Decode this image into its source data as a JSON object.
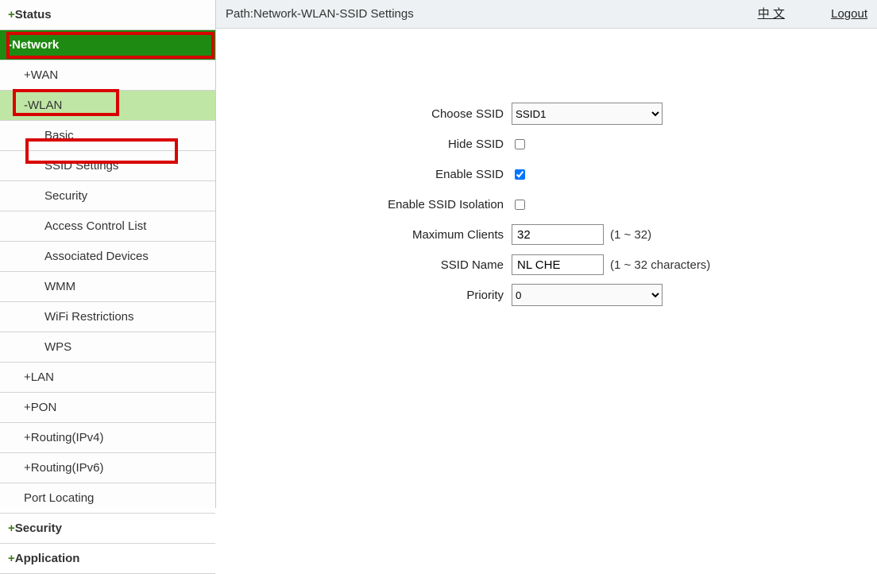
{
  "sidebar": {
    "status": {
      "label": "Status",
      "prefix": "+"
    },
    "network": {
      "label": "Network",
      "prefix": "-"
    },
    "wan": {
      "label": "WAN",
      "prefix": "+"
    },
    "wlan": {
      "label": "WLAN",
      "prefix": "-"
    },
    "basic": {
      "label": "Basic"
    },
    "ssid": {
      "label": "SSID Settings"
    },
    "security_w": {
      "label": "Security"
    },
    "acl": {
      "label": "Access Control List"
    },
    "assoc": {
      "label": "Associated Devices"
    },
    "wmm": {
      "label": "WMM"
    },
    "wifirest": {
      "label": "WiFi Restrictions"
    },
    "wps": {
      "label": "WPS"
    },
    "lan": {
      "label": "LAN",
      "prefix": "+"
    },
    "pon": {
      "label": "PON",
      "prefix": "+"
    },
    "r4": {
      "label": "Routing(IPv4)",
      "prefix": "+"
    },
    "r6": {
      "label": "Routing(IPv6)",
      "prefix": "+"
    },
    "portloc": {
      "label": "Port Locating"
    },
    "security": {
      "label": "Security",
      "prefix": "+"
    },
    "application": {
      "label": "Application",
      "prefix": "+"
    }
  },
  "topbar": {
    "path": "Path:Network-WLAN-SSID Settings",
    "lang": "中 文",
    "logout": "Logout"
  },
  "form": {
    "choose_ssid": {
      "label": "Choose SSID",
      "value": "SSID1"
    },
    "hide_ssid": {
      "label": "Hide SSID",
      "checked": false
    },
    "enable_ssid": {
      "label": "Enable SSID",
      "checked": true
    },
    "isolation": {
      "label": "Enable SSID Isolation",
      "checked": false
    },
    "max_clients": {
      "label": "Maximum Clients",
      "value": "32",
      "hint": "(1 ~ 32)"
    },
    "ssid_name": {
      "label": "SSID Name",
      "value": "NL CHE",
      "hint": "(1 ~ 32 characters)"
    },
    "priority": {
      "label": "Priority",
      "value": "0"
    }
  }
}
